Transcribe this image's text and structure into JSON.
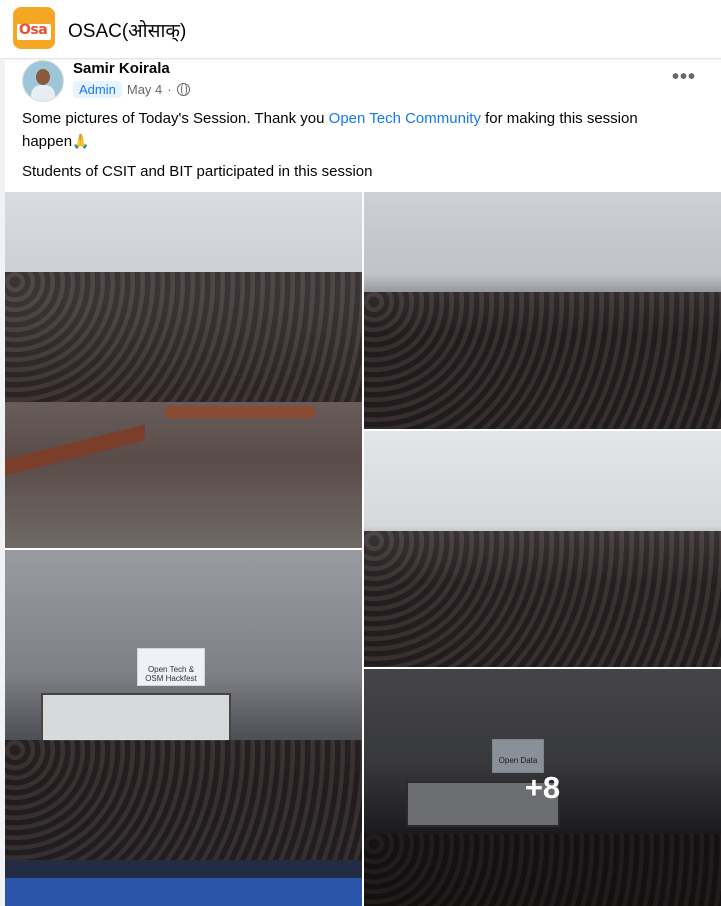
{
  "group": {
    "name": "OSAC(ओसाक्)",
    "logo_text": "Osa"
  },
  "post": {
    "author": "Samir Koirala",
    "badge": "Admin",
    "date": "May 4",
    "separator": "·",
    "more_icon": "more-horizontal-icon",
    "privacy_icon": "globe-icon",
    "text_line1_before": "Some pictures of Today's Session. Thank you ",
    "text_link": "Open Tech Community",
    "text_line1_after": " for making this session happen",
    "emoji": "🙏",
    "text_line2": "Students of CSIT and BIT participated in this session",
    "screen_texts": [
      "Open Tech & OSM Hackfest",
      "Open Data"
    ],
    "more_photos_label": "+8"
  },
  "colors": {
    "link": "#1877f2",
    "badge_bg": "#e7f3ff",
    "logo_bg": "#f5a623"
  }
}
